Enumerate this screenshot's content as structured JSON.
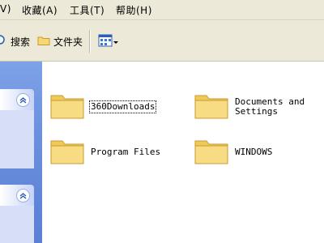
{
  "menubar": {
    "items": [
      {
        "label": "V)"
      },
      {
        "label": "收藏(A)"
      },
      {
        "label": "工具(T)"
      },
      {
        "label": "帮助(H)"
      }
    ]
  },
  "toolbar": {
    "search_label": "搜索",
    "folders_label": "文件夹"
  },
  "files": [
    {
      "name": "360Downloads",
      "selected": true
    },
    {
      "name": "Documents and\nSettings"
    },
    {
      "name": "Program Files"
    },
    {
      "name": "WINDOWS"
    }
  ],
  "icons": {
    "folder": "folder-icon",
    "search": "search-icon",
    "folders": "folder-icon",
    "views": "views-icon",
    "collapse": "chevron-up-icon"
  },
  "colors": {
    "taskpane": "#6b90de",
    "menubar": "#ece9d8",
    "folder": "#f3d36a"
  }
}
